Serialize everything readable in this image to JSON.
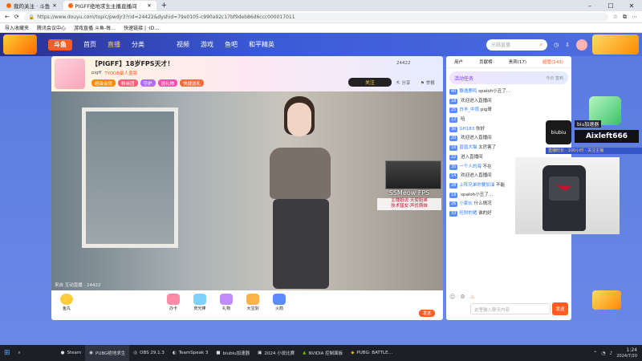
{
  "browser": {
    "tabs": [
      {
        "label": "我的关注 · 斗鱼",
        "active": false
      },
      {
        "label": "PIGFF绝地求生主播直播间",
        "active": true
      }
    ],
    "url": "https://www.douyu.com/topic/pwdjr3?rid=24422&dyshid=79e0105-c990a92c17bf9deb86d6ccc000017011",
    "bookmarks": [
      "导入收藏夹",
      "腾讯会议中心",
      "游戏直播 斗鱼-每…",
      "快速链接 | ·ID…"
    ]
  },
  "site_nav": {
    "logo_text": "斗鱼",
    "items": [
      "首页",
      "直播",
      "分类",
      "视频",
      "游戏",
      "鱼吧",
      "和平精英"
    ],
    "active_index": 1,
    "search_placeholder": "光临直播"
  },
  "room": {
    "title": "【PIGFF】18岁FPS天才！",
    "streamer": "pigff",
    "hot_label": "TYOOB最人皇版",
    "badges": [
      "超级会员",
      "粉丝团",
      "守护",
      "送礼物",
      "快捷送礼"
    ],
    "follow_label": "关注",
    "share_label": "分享",
    "report_label": "举报",
    "room_id": "24422",
    "video_caption": "来自 互动直播 · 24422"
  },
  "pip": {
    "name": "SSMeow FPS",
    "line1": "主播姐说·天使姐弟",
    "line2": "技术猛女·声优萌妹"
  },
  "gift_bar": {
    "gifts": [
      "鱼丸",
      "办卡",
      "荧光棒",
      "礼物",
      "大宝剑",
      "火箭"
    ],
    "send_label": "发送"
  },
  "chat": {
    "tabs": [
      "用户",
      "贡献榜",
      "贵宾(17)",
      "超管(143)"
    ],
    "banner": "活动任务",
    "banner_sub": "今日 签到",
    "messages": [
      {
        "level": "40",
        "user": "飘逸鹿鸣",
        "text": "spaloh小丑了…"
      },
      {
        "level": "18",
        "user": "",
        "text": "欢迎进入直播间"
      },
      {
        "level": "25",
        "user": "白羊_中雨",
        "text": "pig哥"
      },
      {
        "level": "12",
        "user": "",
        "text": "哈"
      },
      {
        "level": "30",
        "user": "GH183",
        "text": "你好"
      },
      {
        "level": "20",
        "user": "",
        "text": "欢迎进入直播间"
      },
      {
        "level": "16",
        "user": "兽兽大猫",
        "text": "太厉害了"
      },
      {
        "level": "22",
        "user": "",
        "text": "进入直播间"
      },
      {
        "level": "35",
        "user": "一个人的海",
        "text": "不在"
      },
      {
        "level": "14",
        "user": "",
        "text": "欢迎进入直播间"
      },
      {
        "level": "28",
        "user": "上阵兄弟你要加油",
        "text": "不能"
      },
      {
        "level": "19",
        "user": "",
        "text": "spaloh小丑了…"
      },
      {
        "level": "26",
        "user": "小家伙",
        "text": "什么情况"
      },
      {
        "level": "33",
        "user": "旺财的猪",
        "text": "谁的好"
      }
    ],
    "input_placeholder": "这里输入聊天内容",
    "send_label": "发送"
  },
  "overlay": {
    "brand": "biubiu",
    "big_text": "Aixleft666",
    "small_text": "biu加速器",
    "ticker": "直播时长 · 100小时 · 关注主播"
  },
  "taskbar": {
    "apps": [
      "Steam",
      "PUBG绝地求生",
      "OBS 29.1.3",
      "TeamSpeak 3",
      "biubiu加速器",
      "2024 小说比赛",
      "NVIDIA 控制面板",
      "PUBG: BATTLE…"
    ],
    "time": "1:24",
    "date": "2024/7/20"
  },
  "colors": {
    "accent": "#ff5d23",
    "brand_blue": "#3a59d6"
  }
}
